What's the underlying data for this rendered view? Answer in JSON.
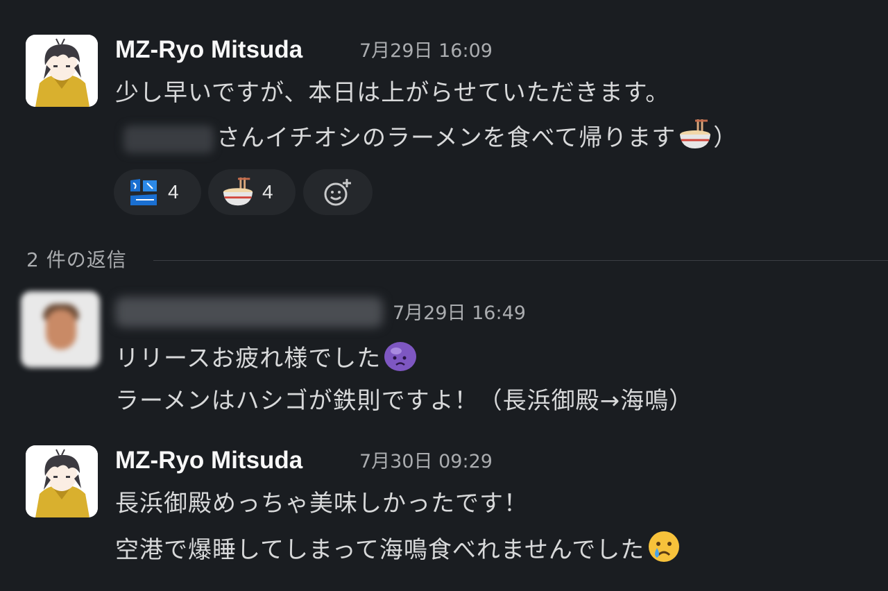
{
  "messages": [
    {
      "author": "MZ-Ryo Mitsuda",
      "timestamp": "7月29日 16:09",
      "lines": [
        "少し早いですが、本日は上がらせていただきます。",
        "さんイチオシのラーメンを食べて帰ります",
        "）"
      ],
      "emoji": "ramen-emoji"
    },
    {
      "author": "",
      "timestamp": "7月29日 16:49",
      "lines": [
        "リリースお疲れ様でした",
        "ラーメンはハシゴが鉄則ですよ！（長浜御殿→海鳴）"
      ],
      "emoji": "purple-blob-emoji"
    },
    {
      "author": "MZ-Ryo Mitsuda",
      "timestamp": "7月30日 09:29",
      "lines": [
        "長浜御殿めっちゃ美味しかったです！",
        "空港で爆睡してしまって海鳴食べれませんでした"
      ],
      "emoji": "crying-face-emoji"
    }
  ],
  "reactions": [
    {
      "icon": "otsukare-summer-emoji",
      "count": "4"
    },
    {
      "icon": "ramen-emoji",
      "count": "4"
    }
  ],
  "add_reaction_icon": "add-reaction-icon",
  "replies_label": "2 件の返信",
  "colors": {
    "background": "#1a1d21",
    "text": "#d8d9da",
    "name": "#f8f8f8",
    "muted": "#abadb0",
    "reaction_bg": "#25282c"
  }
}
